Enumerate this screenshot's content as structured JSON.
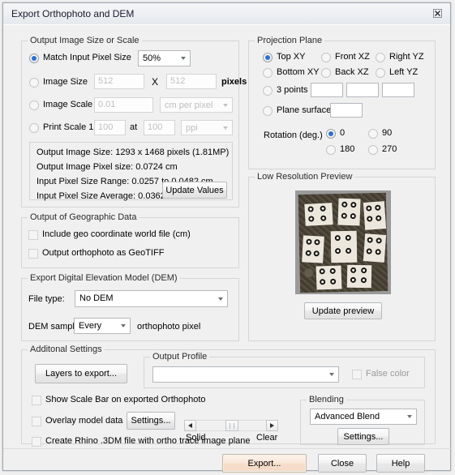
{
  "window": {
    "title": "Export Orthophoto and DEM",
    "close_label": "Close window"
  },
  "output_size": {
    "legend": "Output Image Size or Scale",
    "match_input_label": "Match Input Pixel Size",
    "match_input_selected": true,
    "match_input_value": "50%",
    "image_size_label": "Image Size",
    "image_size_width": "512",
    "image_size_x": "X",
    "image_size_height": "512",
    "image_size_units": "pixels",
    "image_scale_label": "Image Scale",
    "image_scale_value": "0.01",
    "image_scale_units": "cm per pixel",
    "print_scale_label": "Print Scale 1:",
    "print_scale_value": "100",
    "print_scale_at": "at",
    "print_scale_dpi": "100",
    "print_scale_units": "ppi",
    "info": {
      "line1": "Output Image Size: 1293 x 1468 pixels (1.81MP)",
      "line2": "Output Image Pixel size: 0.0724 cm",
      "line3": "Input Pixel Size Range: 0.0257 to 0.0482 cm",
      "line4": "Input Pixel Size Average: 0.0362 cm",
      "update_values_label": "Update Values"
    }
  },
  "geographic": {
    "legend": "Output of Geographic Data",
    "world_file_label": "Include geo coordinate world file (cm)",
    "world_file_checked": false,
    "geotiff_label": "Output orthophoto as GeoTIFF",
    "geotiff_checked": false
  },
  "dem": {
    "legend": "Export Digital Elevation Model (DEM)",
    "file_type_label": "File type:",
    "file_type_value": "No DEM",
    "sample_label": "DEM sample",
    "sample_value": "Every",
    "sample_suffix": "orthophoto pixel"
  },
  "projection": {
    "legend": "Projection Plane",
    "options": [
      {
        "label": "Top XY",
        "selected": true
      },
      {
        "label": "Front XZ",
        "selected": false
      },
      {
        "label": "Right YZ",
        "selected": false
      },
      {
        "label": "Bottom XY",
        "selected": false
      },
      {
        "label": "Back XZ",
        "selected": false
      },
      {
        "label": "Left YZ",
        "selected": false
      }
    ],
    "three_points_label": "3 points",
    "three_points_selected": false,
    "three_points_values": [
      "",
      "",
      ""
    ],
    "plane_surface_label": "Plane surface",
    "plane_surface_selected": false,
    "plane_surface_value": "",
    "rotation_label": "Rotation (deg.)",
    "rotation_options": [
      {
        "label": "0",
        "selected": true
      },
      {
        "label": "90",
        "selected": false
      },
      {
        "label": "180",
        "selected": false
      },
      {
        "label": "270",
        "selected": false
      }
    ]
  },
  "preview": {
    "legend": "Low Resolution Preview",
    "update_label": "Update preview"
  },
  "additional": {
    "legend": "Additonal Settings",
    "layers_button": "Layers to export...",
    "output_profile_legend": "Output Profile",
    "output_profile_value": "",
    "false_color_label": "False color",
    "false_color_checked": false,
    "scale_bar_label": "Show Scale Bar on exported Orthophoto",
    "scale_bar_checked": false,
    "overlay_label": "Overlay model data",
    "overlay_checked": false,
    "overlay_settings_label": "Settings...",
    "slider_left_label": "Solid",
    "slider_right_label": "Clear",
    "rhino_label": "Create Rhino .3DM file with ortho trace image plane",
    "rhino_checked": false,
    "blending_legend": "Blending",
    "blending_value": "Advanced Blend",
    "blending_settings_label": "Settings..."
  },
  "footer": {
    "export_label": "Export...",
    "close_label": "Close",
    "help_label": "Help"
  },
  "colors": {
    "accent": "#2f6fd0",
    "export_highlight": "#f7ddc9",
    "dialog_bg": "#f0f0f0"
  }
}
